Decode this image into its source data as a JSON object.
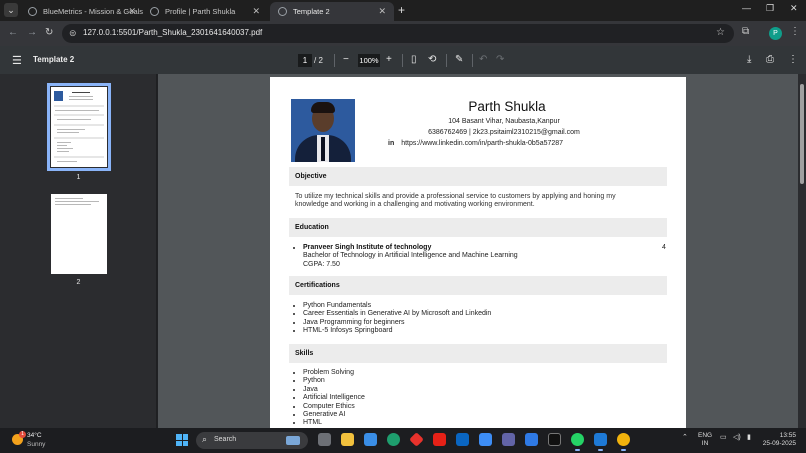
{
  "browser": {
    "tabs": [
      {
        "title": "BlueMetrics - Mission & Goals",
        "active": false
      },
      {
        "title": "Profile | Parth Shukla",
        "active": false
      },
      {
        "title": "Template 2",
        "active": true
      }
    ],
    "url": "127.0.0.1:5501/Parth_Shukla_2301641640037.pdf",
    "profile_initial": "P",
    "profile_color": "#0f9d8a"
  },
  "pdf_toolbar": {
    "title": "Template 2",
    "current_page": "1",
    "page_separator": "/  2",
    "zoom": "100%"
  },
  "thumbnails": [
    {
      "label": "1",
      "selected": true
    },
    {
      "label": "2",
      "selected": false
    }
  ],
  "resume": {
    "name": "Parth Shukla",
    "address": "104 Basant Vihar, Naubasta,Kanpur",
    "contact": "6386762469  |  2k23.psitaiml2310215@gmail.com",
    "linkedin_icon": "in",
    "linkedin_url": "https://www.linkedin.com/in/parth-shukla-0b5a57287",
    "sections": {
      "objective": {
        "heading": "Objective",
        "text": "To utilize my technical skills and provide a professional service to customers by applying and honing my knowledge and working in a challenging and motivating working environment."
      },
      "education": {
        "heading": "Education",
        "institute": "Pranveer Singh Institute of technology",
        "degree": "Bachelor of Technology in Artificial Intelligence and Machine Learning",
        "cgpa": "CGPA: 7.50",
        "side_value": "4"
      },
      "certifications": {
        "heading": "Certifications",
        "items": [
          "Python Fundamentals",
          "Career Essentials in Generative AI by Microsoft and Linkedin",
          "Java Programming for beginners",
          "HTML-5 Infosys Springboard"
        ]
      },
      "skills": {
        "heading": "Skills",
        "items": [
          "Problem Solving",
          "Python",
          "Java",
          "Artificial Intelligence",
          "Computer Ethics",
          "Generative AI",
          "HTML"
        ]
      }
    }
  },
  "taskbar": {
    "weather_temp": "34°C",
    "weather_cond": "Sunny",
    "weather_badge": "1",
    "search_label": "Search",
    "lang_top": "ENG",
    "lang_bottom": "IN",
    "time": "13:55",
    "date": "25-09-2025"
  }
}
